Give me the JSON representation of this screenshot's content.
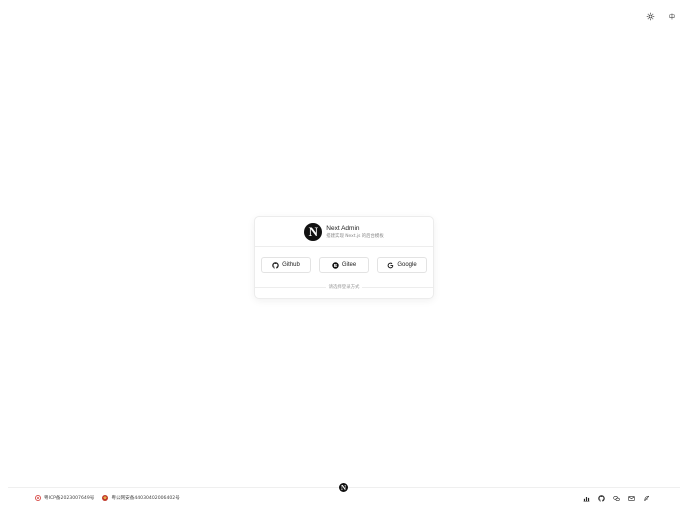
{
  "top_tools": {
    "theme_icon": "sun-icon",
    "lang_label": "中"
  },
  "card": {
    "logo_letter": "N",
    "title": "Next Admin",
    "subtitle": "搭建实现 Next.js 的后台模板",
    "buttons": [
      {
        "label": "Github",
        "icon": "github-icon"
      },
      {
        "label": "Gitee",
        "icon": "gitee-icon"
      },
      {
        "label": "Google",
        "icon": "google-icon"
      }
    ],
    "divider_text": "请选择登录方式"
  },
  "footer": {
    "logo_letter": "N",
    "icp_text": "粤ICP备2023007649号",
    "police_text": "粤公网安备44030402006402号",
    "icons": [
      "stats-icon",
      "github-icon",
      "wechat-icon",
      "mail-icon",
      "feather-icon"
    ]
  },
  "colors": {
    "accent": "#111111",
    "border": "#ececec",
    "muted": "#888888"
  }
}
